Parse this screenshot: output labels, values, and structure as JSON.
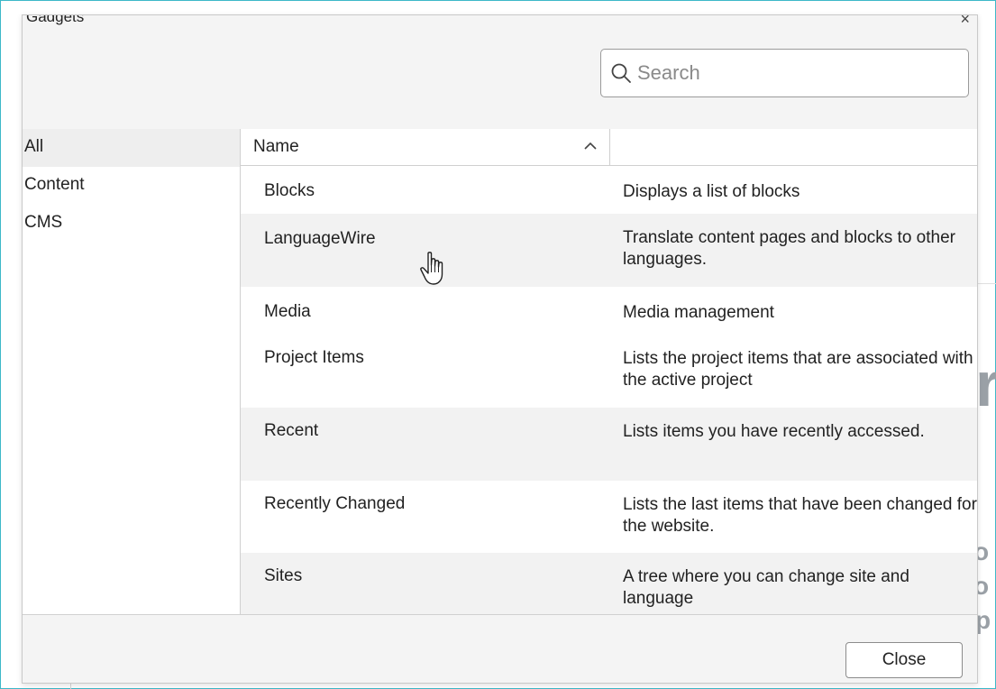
{
  "dialog": {
    "title_partial": "Gadgets",
    "close_glyph": "×"
  },
  "search": {
    "placeholder": "Search",
    "value": ""
  },
  "categories": [
    {
      "label": "All",
      "selected": true
    },
    {
      "label": "Content",
      "selected": false
    },
    {
      "label": "CMS",
      "selected": false
    }
  ],
  "table": {
    "columns": [
      "Name",
      ""
    ],
    "sort": "ascending",
    "rows": [
      {
        "name": "Blocks",
        "description": "Displays a list of blocks"
      },
      {
        "name": "LanguageWire",
        "description": "Translate content pages and blocks to other languages."
      },
      {
        "name": "Media",
        "description": "Media management"
      },
      {
        "name": "Project Items",
        "description": "Lists the project items that are associated with the active project"
      },
      {
        "name": "Recent",
        "description": "Lists items you have recently accessed."
      },
      {
        "name": "Recently Changed",
        "description": "Lists the last items that have been changed for the website."
      },
      {
        "name": "Sites",
        "description": "A tree where you can change site and language"
      }
    ]
  },
  "footer": {
    "close_label": "Close"
  },
  "icons": {
    "search": "search-icon",
    "sort": "chevron-up-icon",
    "cursor": "hand-pointer-icon"
  },
  "colors": {
    "frame_border": "#3db8c8",
    "selected_bg": "#eeeeee",
    "alt_row_bg": "#f2f2f2",
    "panel_bg": "#f4f4f4"
  }
}
